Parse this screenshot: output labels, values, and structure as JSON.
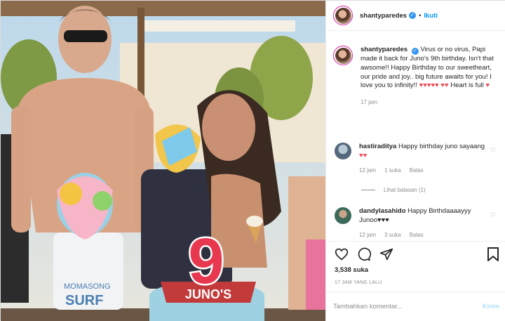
{
  "post": {
    "username": "shantyparedes",
    "follow_label": "Ikuti",
    "caption": "Virus or no virus, Papi made it back for Juno's 9th birthday. Isn't that awsome!! Happy Birthday to our sweetheart, our pride and joy.. big future awaits for you! I love you to infinity!!",
    "caption_end": "Heart is full",
    "caption_time": "17 jam"
  },
  "comments": [
    {
      "username": "hastiraditya",
      "text": "Happy birthday juno sayaang",
      "time": "12 jam",
      "likes": "1 suka",
      "reply_label": "Balas"
    },
    {
      "username": "dandylasahido",
      "text": "Happy Birthdaaaayyy Junoo♥♥♥",
      "time": "12 jam",
      "likes": "3 suka",
      "reply_label": "Balas"
    }
  ],
  "view_replies_label": "Lihat balasan (1)",
  "likes_count": "3,538 suka",
  "post_age": "17 JAM YANG LALU",
  "comment_box": {
    "placeholder": "Tambahkan komentar...",
    "post_label": "Kirim"
  },
  "photo": {
    "cake_number": "9",
    "cake_banner": "JUNO'S",
    "shirt_text_1": "MOMASONG",
    "shirt_text_2": "SURF"
  },
  "colors": {
    "accent": "#0095f6",
    "heart": "#ed4956",
    "muted": "#8e8e8e"
  }
}
